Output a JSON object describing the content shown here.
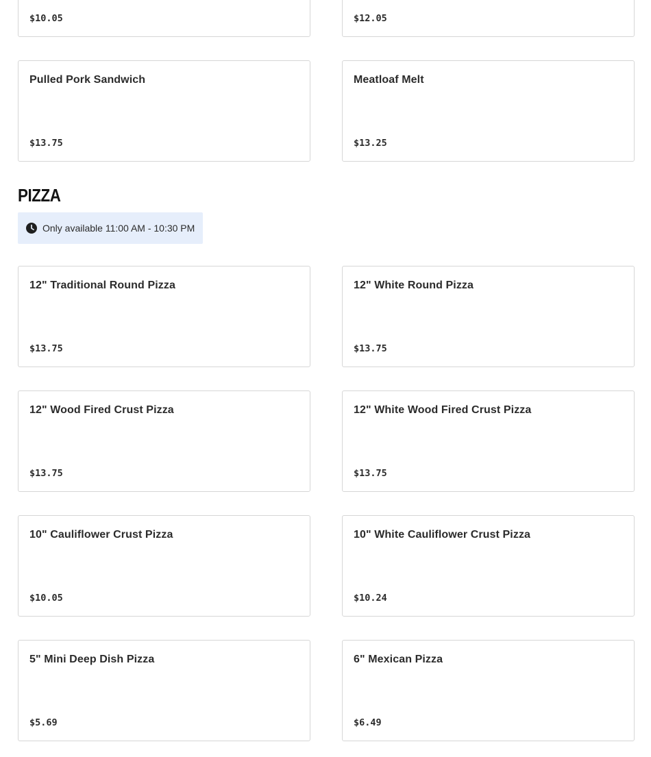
{
  "sandwich_items": [
    {
      "name": "",
      "price": "$10.05"
    },
    {
      "name": "",
      "price": "$12.05"
    },
    {
      "name": "Pulled Pork Sandwich",
      "price": "$13.75"
    },
    {
      "name": "Meatloaf Melt",
      "price": "$13.25"
    }
  ],
  "pizza_section": {
    "title": "PIZZA",
    "availability": "Only available 11:00 AM - 10:30 PM",
    "items": [
      {
        "name": "12\" Traditional Round Pizza",
        "price": "$13.75"
      },
      {
        "name": "12\" White Round Pizza",
        "price": "$13.75"
      },
      {
        "name": "12\" Wood Fired Crust Pizza",
        "price": "$13.75"
      },
      {
        "name": "12\" White Wood Fired Crust Pizza",
        "price": "$13.75"
      },
      {
        "name": "10\" Cauliflower Crust Pizza",
        "price": "$10.05"
      },
      {
        "name": "10\" White Cauliflower Crust Pizza",
        "price": "$10.24"
      },
      {
        "name": "5\" Mini Deep Dish Pizza",
        "price": "$5.69"
      },
      {
        "name": "6\" Mexican Pizza",
        "price": "$6.49"
      }
    ]
  },
  "icons": {
    "availability_icon": "clock-icon"
  }
}
